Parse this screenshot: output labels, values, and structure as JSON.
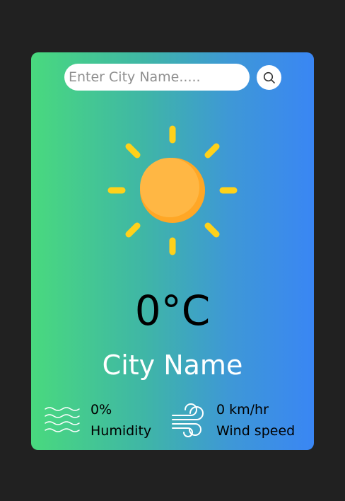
{
  "search": {
    "placeholder": "Enter City Name.....",
    "button_icon": "search-icon"
  },
  "weather": {
    "icon": "sun-icon",
    "temperature": "0°C",
    "city": "City Name"
  },
  "details": {
    "humidity": {
      "icon": "humidity-icon",
      "value": "0%",
      "label": "Humidity"
    },
    "wind": {
      "icon": "wind-icon",
      "value": "0 km/hr",
      "label": "Wind speed"
    }
  },
  "colors": {
    "background": "#212121",
    "gradient_start": "#49d97e",
    "gradient_end": "#3a86f4",
    "sun_ray": "#ffd11a",
    "sun_body": "#ffb13b"
  }
}
